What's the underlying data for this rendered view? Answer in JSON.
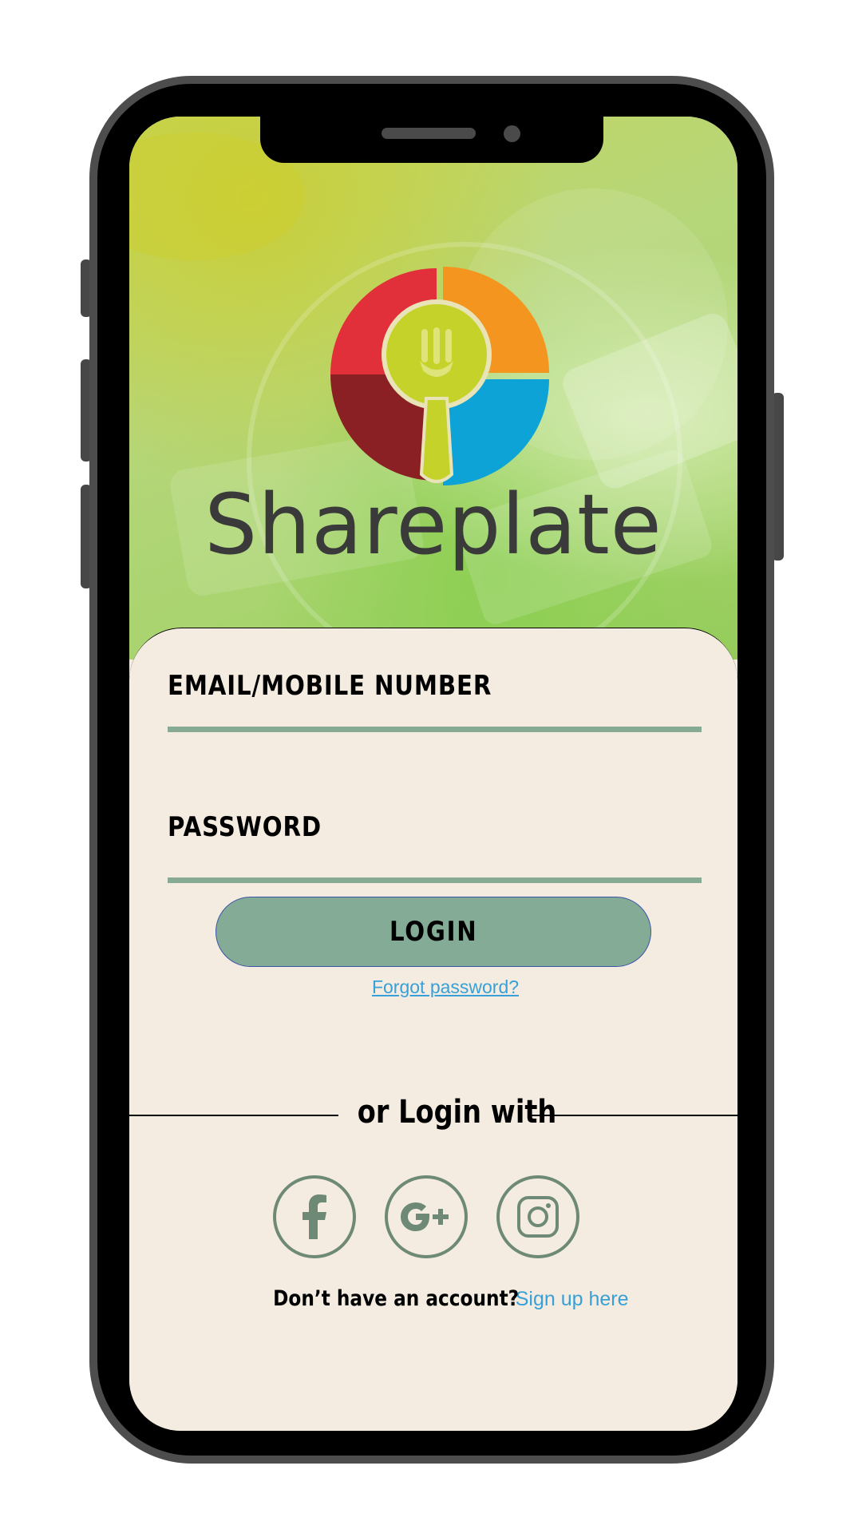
{
  "app": {
    "brand_name": "Shareplate"
  },
  "login_form": {
    "email_label": "EMAIL/MOBILE NUMBER",
    "email_value": "",
    "password_label": "PASSWORD",
    "password_value": "",
    "login_button_label": "LOGIN",
    "forgot_password_link": "Forgot password?"
  },
  "social_login": {
    "divider_text": "or Login with",
    "providers": [
      {
        "name": "Facebook",
        "icon": "facebook-icon"
      },
      {
        "name": "Google+",
        "icon": "google-plus-icon"
      },
      {
        "name": "Instagram",
        "icon": "instagram-icon"
      }
    ]
  },
  "signup": {
    "prompt": "Don’t have an account?",
    "link_label": "Sign up here"
  },
  "colors": {
    "accent_green": "#84ab95",
    "link_blue": "#38a0d8",
    "card_background": "#f4ece0",
    "logo_red": "#e2303a",
    "logo_dark_red": "#8a1f24",
    "logo_orange": "#f4951f",
    "logo_blue": "#0ea3d6",
    "logo_lime": "#c4d22a"
  }
}
